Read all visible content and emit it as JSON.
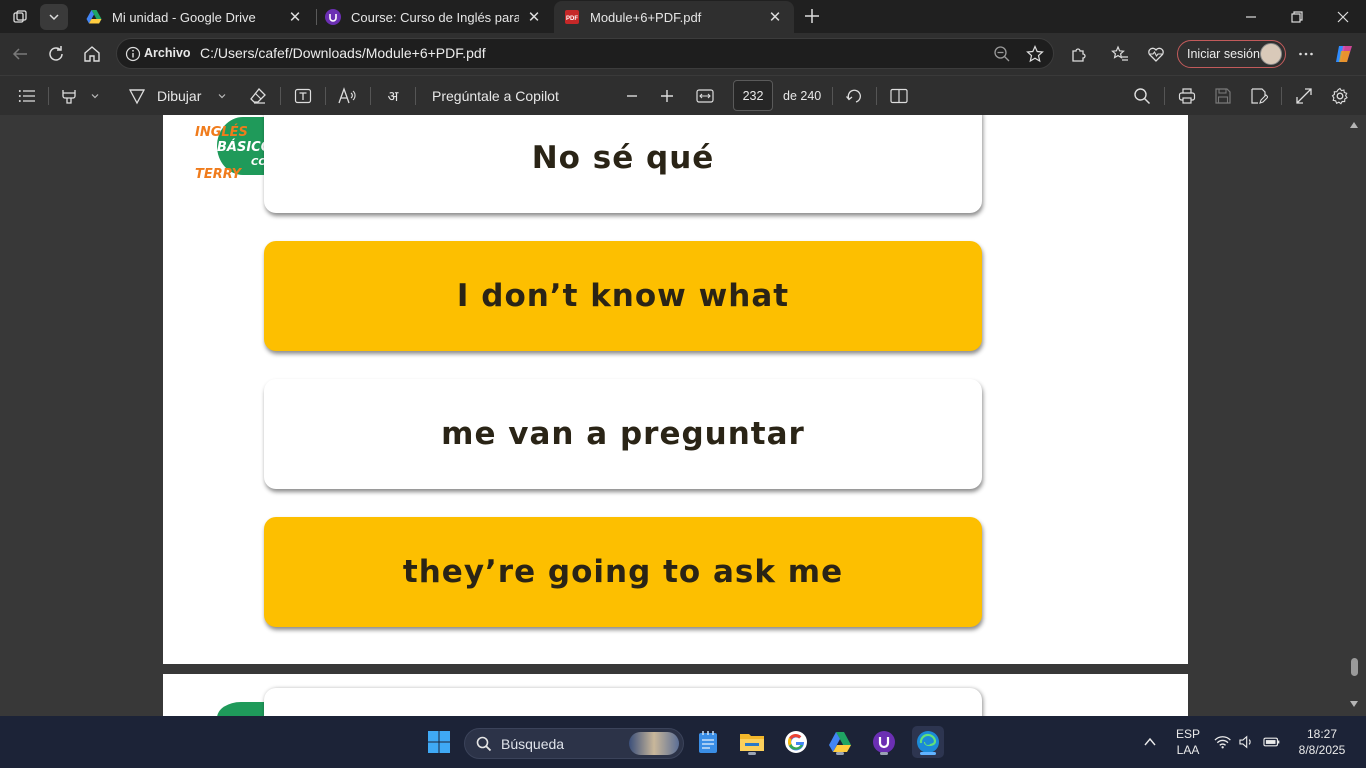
{
  "browser": {
    "tabs": [
      {
        "title": "Mi unidad - Google Drive",
        "active": false
      },
      {
        "title": "Course: Curso de Inglés para principiantes",
        "active": false
      },
      {
        "title": "Module+6+PDF.pdf",
        "active": true
      }
    ],
    "address": {
      "scheme_label": "Archivo",
      "url": "C:/Users/cafef/Downloads/Module+6+PDF.pdf"
    },
    "signin_label": "Iniciar sesión"
  },
  "pdf_toolbar": {
    "draw_label": "Dibujar",
    "copilot_label": "Pregúntale a Copilot",
    "current_page": "232",
    "total_pages_label": "de 240"
  },
  "document": {
    "logo_text": {
      "line1": "INGLÉS",
      "line2": "BÁSICO",
      "line3": "CO",
      "line4": "TERRY"
    },
    "cards": [
      {
        "text": "No sé qué",
        "style": "white"
      },
      {
        "text": "I don’t know what",
        "style": "gold"
      },
      {
        "text": "me van a preguntar",
        "style": "white"
      },
      {
        "text": "they’re going to ask me",
        "style": "gold"
      }
    ]
  },
  "taskbar": {
    "search_placeholder": "Búsqueda",
    "language": "ESP",
    "layout": "LAA",
    "time": "18:27",
    "date": "8/8/2025"
  },
  "colors": {
    "card_gold": "#fdbf00",
    "logo_green": "#1f9a5a",
    "logo_orange": "#f07c1c",
    "signin_border": "#c25b5b"
  }
}
